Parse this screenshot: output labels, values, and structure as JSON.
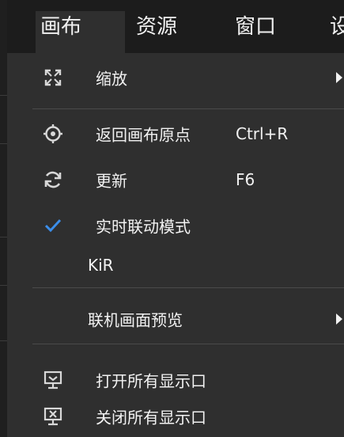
{
  "menubar": {
    "items": [
      {
        "label": "画布"
      },
      {
        "label": "资源"
      },
      {
        "label": "窗口"
      },
      {
        "label": "设"
      }
    ]
  },
  "dropdown": {
    "items": [
      {
        "label": "缩放",
        "icon": "zoom-fit-icon",
        "has_submenu": true
      },
      {
        "label": "返回画布原点",
        "shortcut": "Ctrl+R",
        "icon": "target-icon"
      },
      {
        "label": "更新",
        "shortcut": "F6",
        "icon": "refresh-icon"
      },
      {
        "label": "实时联动模式",
        "icon": "check-icon",
        "checked": true
      },
      {
        "label": "KiR"
      },
      {
        "label": "联机画面预览",
        "has_submenu": true
      },
      {
        "label": "打开所有显示口",
        "icon": "monitor-download-icon"
      },
      {
        "label": "关闭所有显示口",
        "icon": "monitor-close-icon"
      }
    ]
  },
  "colors": {
    "background": "#2f2f2f",
    "menubar": "#1c1c1c",
    "text": "#f2f2f2",
    "check": "#3b8eea",
    "separator": "#4a4a4a"
  }
}
